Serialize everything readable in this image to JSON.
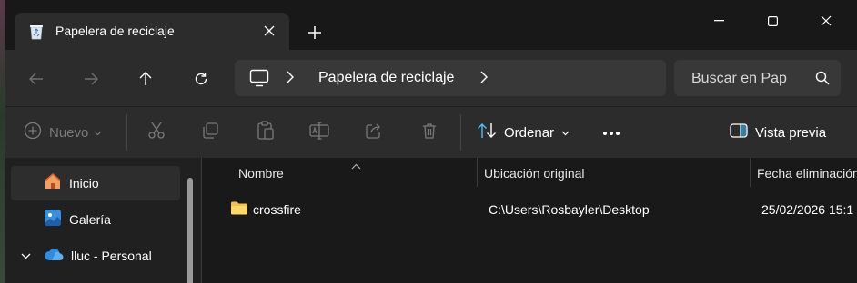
{
  "window": {
    "tab_title": "Papelera de reciclaje"
  },
  "address": {
    "location": "Papelera de reciclaje",
    "search_placeholder": "Buscar en Pap"
  },
  "commands": {
    "new": "Nuevo",
    "sort": "Ordenar",
    "preview": "Vista previa"
  },
  "sidebar": {
    "items": [
      {
        "label": "Inicio",
        "icon": "home-icon",
        "selected": true
      },
      {
        "label": "Galería",
        "icon": "gallery-icon",
        "selected": false
      },
      {
        "label": "lluc - Personal",
        "icon": "onedrive-cloud-icon",
        "selected": false
      }
    ]
  },
  "table": {
    "columns": [
      "Nombre",
      "Ubicación original",
      "Fecha eliminación"
    ],
    "rows": [
      {
        "name": "crossfire",
        "location": "C:\\Users\\Rosbayler\\Desktop",
        "date": "25/02/2026 15:1"
      }
    ]
  },
  "colors": {
    "accent": "#4cc2ff",
    "folder": "#f2c14e"
  }
}
